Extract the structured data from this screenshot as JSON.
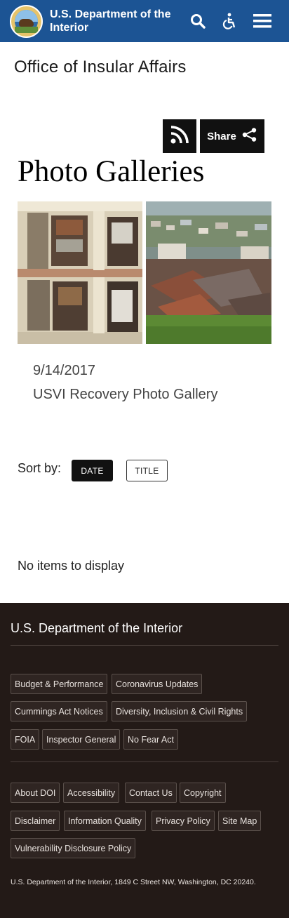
{
  "header": {
    "brand_line1": "U.S. Department of the",
    "brand_line2": "Interior",
    "search_icon": "search-icon",
    "accessibility_icon": "accessibility-icon",
    "menu_icon": "hamburger-menu-icon",
    "bg_color": "#1c5494"
  },
  "office": {
    "name": "Office of Insular Affairs"
  },
  "actions": {
    "rss_icon": "rss-icon",
    "share_label": "Share",
    "share_icon": "share-icon"
  },
  "page": {
    "title": "Photo Galleries"
  },
  "gallery": {
    "date": "9/14/2017",
    "title": "USVI Recovery Photo Gallery"
  },
  "sort": {
    "label": "Sort by:",
    "options": [
      "DATE",
      "TITLE"
    ],
    "selected": "DATE"
  },
  "results": {
    "empty_message": "No items to display"
  },
  "footer": {
    "title": "U.S. Department of the Interior",
    "links_primary": [
      "Budget & Performance",
      "Coronavirus Updates",
      "Cummings Act Notices",
      "Diversity, Inclusion & Civil Rights",
      "FOIA",
      "Inspector General",
      "No Fear Act"
    ],
    "links_secondary": [
      "About DOI",
      "Accessibility",
      "Contact Us",
      "Copyright",
      "Disclaimer",
      "Information Quality",
      "Privacy Policy",
      "Site Map",
      "Vulnerability Disclosure Policy"
    ],
    "address": "U.S. Department of the Interior, 1849 C Street NW, Washington, DC 20240.",
    "bg_color": "#231a17"
  }
}
